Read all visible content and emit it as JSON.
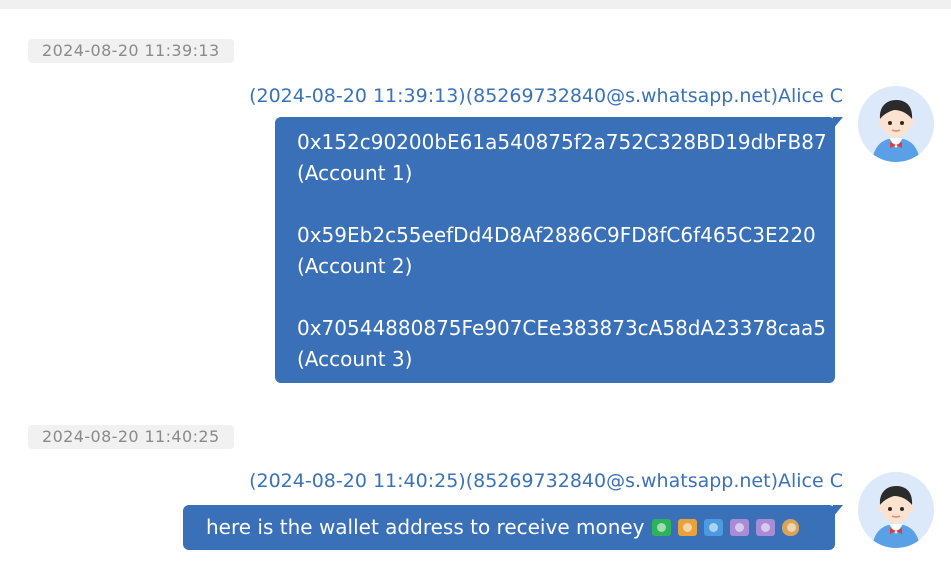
{
  "messages": [
    {
      "timestamp_separator": "2024-08-20 11:39:13",
      "sender_line": "(2024-08-20 11:39:13)(85269732840@s.whatsapp.net)Alice C",
      "lines": [
        "0x152c90200bE61a540875f2a752C328BD19dbFB87",
        "(Account 1)",
        "",
        "0x59Eb2c55eefDd4D8Af2886C9FD8fC6f465C3E220",
        "(Account 2)",
        "",
        "0x70544880875Fe907CEe383873cA58dA23378caa5",
        "(Account 3)"
      ]
    },
    {
      "timestamp_separator": "2024-08-20 11:40:25",
      "sender_line": "(2024-08-20 11:40:25)(85269732840@s.whatsapp.net)Alice C",
      "text": "here is the wallet address to receive money",
      "emojis": [
        {
          "name": "dollar-banknote",
          "color": "#2fb35a"
        },
        {
          "name": "yen-banknote",
          "color": "#e9a23b"
        },
        {
          "name": "euro-banknote",
          "color": "#4a9be0"
        },
        {
          "name": "pound-banknote",
          "color": "#a98bd6"
        },
        {
          "name": "pound-banknote",
          "color": "#a98bd6"
        },
        {
          "name": "money-bag",
          "color": "#d9a35a"
        }
      ]
    }
  ],
  "colors": {
    "bubble": "#3970b7",
    "sender_text": "#3a72b8",
    "timestamp_text": "#8a8a8a",
    "avatar_bg": "#dbe9fa"
  }
}
